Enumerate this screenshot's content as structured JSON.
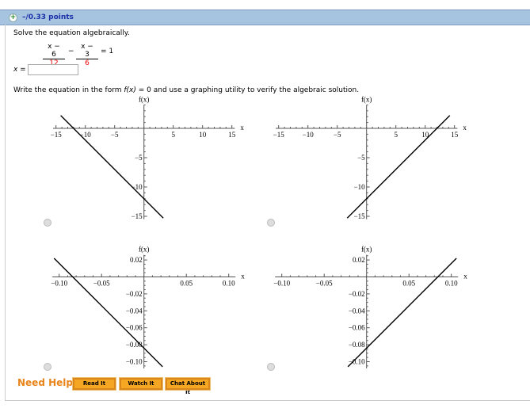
{
  "header": {
    "points": "–/0.33 points",
    "icon": "plus-circle-icon"
  },
  "question": {
    "instruction": "Solve the equation algebraically.",
    "frac1": {
      "num": "x − 6",
      "den": "12"
    },
    "minus": "−",
    "frac2": {
      "num": "x − 3",
      "den": "6"
    },
    "rhs": "= 1",
    "answer_label": "x =",
    "answer_value": "",
    "instruction2_a": "Write the equation in the form ",
    "instruction2_f": "f(x)",
    "instruction2_b": " = 0 and use a graphing utility to verify the algebraic solution."
  },
  "chart_data": [
    {
      "type": "line",
      "xlabel": "x",
      "ylabel": "f(x)",
      "xlim": [
        -15,
        15
      ],
      "ylim": [
        -15,
        3
      ],
      "xticks": [
        -15,
        -10,
        -5,
        5,
        10,
        15
      ],
      "yticks": [
        -5,
        -10,
        -15
      ],
      "xtick_labels": [
        "−15",
        "−10",
        "−5",
        "5",
        "10",
        "15"
      ],
      "ytick_labels": [
        "−5",
        "−10",
        "−15"
      ],
      "series": [
        {
          "x": [
            -14.2,
            3.3
          ],
          "y": [
            2.2,
            -15.3
          ]
        }
      ]
    },
    {
      "type": "line",
      "xlabel": "x",
      "ylabel": "f(x)",
      "xlim": [
        -15,
        15
      ],
      "ylim": [
        -15,
        3
      ],
      "xticks": [
        -15,
        -10,
        -5,
        5,
        10,
        15
      ],
      "yticks": [
        -5,
        -10,
        -15
      ],
      "xtick_labels": [
        "−15",
        "−10",
        "−5",
        "5",
        "10",
        "15"
      ],
      "ytick_labels": [
        "−5",
        "−10",
        "−15"
      ],
      "series": [
        {
          "x": [
            -3.3,
            14.2
          ],
          "y": [
            -15.3,
            2.2
          ]
        }
      ]
    },
    {
      "type": "line",
      "xlabel": "x",
      "ylabel": "f(x)",
      "xlim": [
        -0.1,
        0.1
      ],
      "ylim": [
        -0.1,
        0.02
      ],
      "xticks": [
        -0.1,
        -0.05,
        0.05,
        0.1
      ],
      "yticks": [
        0.02,
        -0.02,
        -0.04,
        -0.06,
        -0.08,
        -0.1
      ],
      "xtick_labels": [
        "−0.10",
        "−0.05",
        "0.05",
        "0.10"
      ],
      "ytick_labels": [
        "0.02",
        "−0.02",
        "−0.04",
        "−0.06",
        "−0.08",
        "−0.10"
      ],
      "series": [
        {
          "x": [
            -0.106,
            0.022
          ],
          "y": [
            0.022,
            -0.106
          ]
        }
      ]
    },
    {
      "type": "line",
      "xlabel": "x",
      "ylabel": "f(x)",
      "xlim": [
        -0.1,
        0.1
      ],
      "ylim": [
        -0.1,
        0.02
      ],
      "xticks": [
        -0.1,
        -0.05,
        0.05,
        0.1
      ],
      "yticks": [
        0.02,
        -0.02,
        -0.04,
        -0.06,
        -0.08,
        -0.1
      ],
      "xtick_labels": [
        "−0.10",
        "−0.05",
        "0.05",
        "0.10"
      ],
      "ytick_labels": [
        "0.02",
        "−0.02",
        "−0.04",
        "−0.06",
        "−0.08",
        "−0.10"
      ],
      "series": [
        {
          "x": [
            -0.022,
            0.106
          ],
          "y": [
            -0.106,
            0.022
          ]
        }
      ]
    }
  ],
  "help": {
    "label": "Need Help?",
    "read": "Read It",
    "watch": "Watch It",
    "chat": "Chat About It"
  }
}
